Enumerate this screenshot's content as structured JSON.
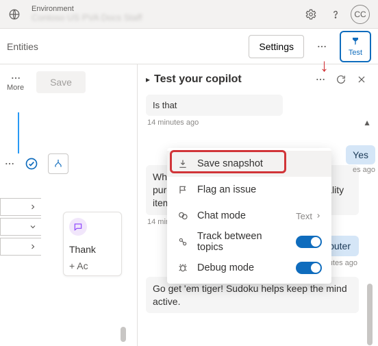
{
  "topbar": {
    "env_label": "Environment",
    "env_value": "Contoso US PVA Docs Staff",
    "avatar_initials": "CC"
  },
  "cmdbar": {
    "entities_label": "Entities",
    "settings_label": "Settings",
    "test_label": "Test"
  },
  "left": {
    "more_label": "More",
    "save_label": "Save",
    "msg_card_title": "Thank",
    "msg_card_add": "+  Ac"
  },
  "test_panel": {
    "title": "Test your copilot",
    "msg1": "Is that",
    "ts1": "14 minutes ago",
    "yes_label": "Yes",
    "yes_ts": "es ago",
    "msg2": "What computer are you interested in purchasing? We are focused on a few quality items.",
    "ts2": "14 minutes ago",
    "user_msg": "Gaming Computer",
    "user_ts": "14 minutes ago",
    "msg3": "Go get 'em tiger! Sudoku helps keep the mind active."
  },
  "menu": {
    "save_snapshot": "Save snapshot",
    "flag_issue": "Flag an issue",
    "chat_mode": "Chat mode",
    "chat_mode_value": "Text",
    "track_topics": "Track between topics",
    "debug_mode": "Debug mode"
  }
}
